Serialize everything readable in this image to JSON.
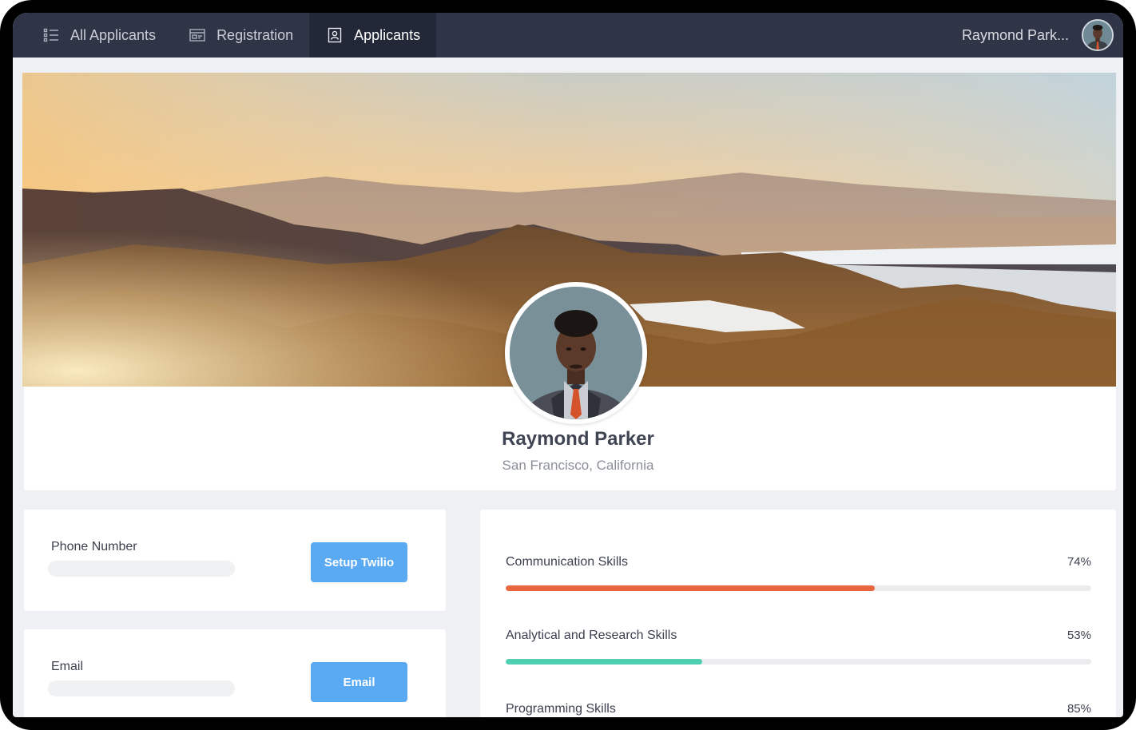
{
  "nav": {
    "tabs": [
      {
        "label": "All Applicants",
        "icon": "list-icon",
        "active": false
      },
      {
        "label": "Registration",
        "icon": "form-icon",
        "active": false
      },
      {
        "label": "Applicants",
        "icon": "contact-card-icon",
        "active": true
      }
    ],
    "user_name": "Raymond Park..."
  },
  "profile": {
    "name": "Raymond Parker",
    "location": "San Francisco, California"
  },
  "contacts": {
    "phone": {
      "label": "Phone Number",
      "button": "Setup Twilio"
    },
    "email": {
      "label": "Email",
      "button": "Email"
    }
  },
  "skills": [
    {
      "name": "Communication Skills",
      "percent_label": "74%",
      "value": 0.63,
      "color": "#e8673f"
    },
    {
      "name": "Analytical and Research Skills",
      "percent_label": "53%",
      "value": 0.335,
      "color": "#4fcfb0"
    },
    {
      "name": "Programming Skills",
      "percent_label": "85%",
      "value": 0.85,
      "color": "#5aaaf3"
    }
  ],
  "colors": {
    "nav_bg": "#2f3546",
    "nav_active_bg": "#222838",
    "button_blue": "#5aaaf3",
    "page_bg": "#eef0f4"
  }
}
